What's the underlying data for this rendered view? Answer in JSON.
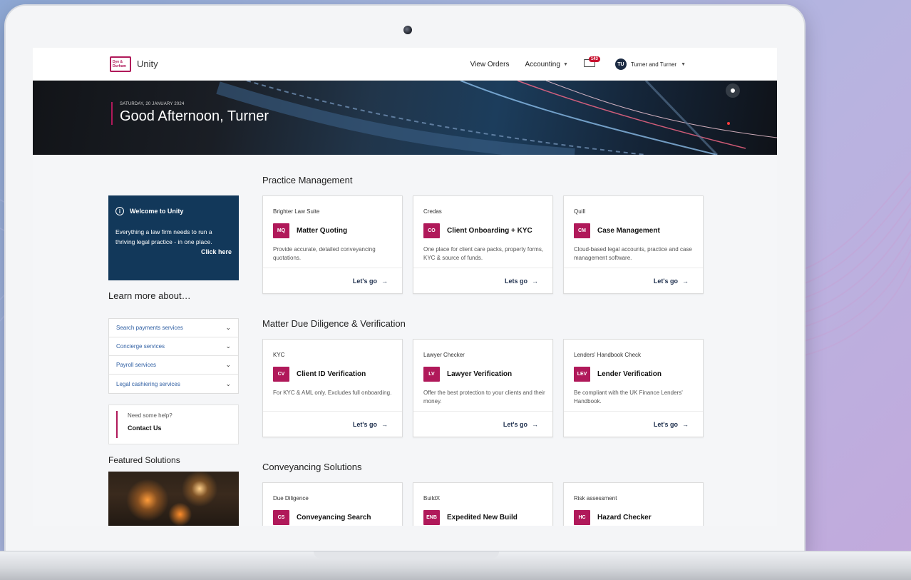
{
  "app": {
    "name": "Unity",
    "logo_text": "Dye & Durham"
  },
  "header": {
    "nav": [
      {
        "label": "View Orders"
      },
      {
        "label": "Accounting"
      }
    ],
    "cart_count": "143",
    "user_initials": "TU",
    "user_name": "Turner and Turner"
  },
  "hero": {
    "date": "SATURDAY, 20 JANUARY 2024",
    "greeting": "Good Afternoon, Turner"
  },
  "sidebar": {
    "welcome": {
      "title": "Welcome to Unity",
      "body": "Everything a law firm needs to run a thriving legal practice - in one place.",
      "link": "Click here"
    },
    "learn_title": "Learn more about…",
    "accordion": [
      {
        "label": "Search payments services"
      },
      {
        "label": "Concierge services"
      },
      {
        "label": "Payroll services"
      },
      {
        "label": "Legal cashiering services"
      }
    ],
    "help": {
      "prompt": "Need some help?",
      "link": "Contact Us"
    },
    "featured_title": "Featured Solutions"
  },
  "sections": [
    {
      "title": "Practice Management",
      "cards": [
        {
          "vendor": "Brighter Law Suite",
          "tag": "MQ",
          "title": "Matter Quoting",
          "desc": "Provide accurate, detailed conveyancing quotations.",
          "cta": "Let's go"
        },
        {
          "vendor": "Credas",
          "tag": "CO",
          "title": "Client Onboarding + KYC",
          "desc": "One place for client care packs, property forms, KYC & source of funds.",
          "cta": "Lets go"
        },
        {
          "vendor": "Quill",
          "tag": "CM",
          "title": "Case Management",
          "desc": "Cloud-based legal accounts, practice and case management software.",
          "cta": "Let's go"
        }
      ]
    },
    {
      "title": "Matter Due Diligence & Verification",
      "cards": [
        {
          "vendor": "KYC",
          "tag": "CV",
          "title": "Client ID Verification",
          "desc": "For KYC & AML only. Excludes full onboarding.",
          "cta": "Let's go"
        },
        {
          "vendor": "Lawyer Checker",
          "tag": "LV",
          "title": "Lawyer Verification",
          "desc": "Offer the best protection to your clients and their money.",
          "cta": "Let's go"
        },
        {
          "vendor": "Lenders' Handbook Check",
          "tag": "LEV",
          "title": "Lender Verification",
          "desc": "Be compliant with the UK Finance Lenders' Handbook.",
          "cta": "Let's go"
        }
      ]
    },
    {
      "title": "Conveyancing Solutions",
      "cards": [
        {
          "vendor": "Due Diligence",
          "tag": "CS",
          "title": "Conveyancing Search"
        },
        {
          "vendor": "BuildX",
          "tag": "ENB",
          "title": "Expedited New Build"
        },
        {
          "vendor": "Risk assessment",
          "tag": "HC",
          "title": "Hazard Checker"
        }
      ]
    }
  ],
  "colors": {
    "brand": "#b0195a",
    "navy": "#12385a",
    "link": "#2f5fa3"
  }
}
